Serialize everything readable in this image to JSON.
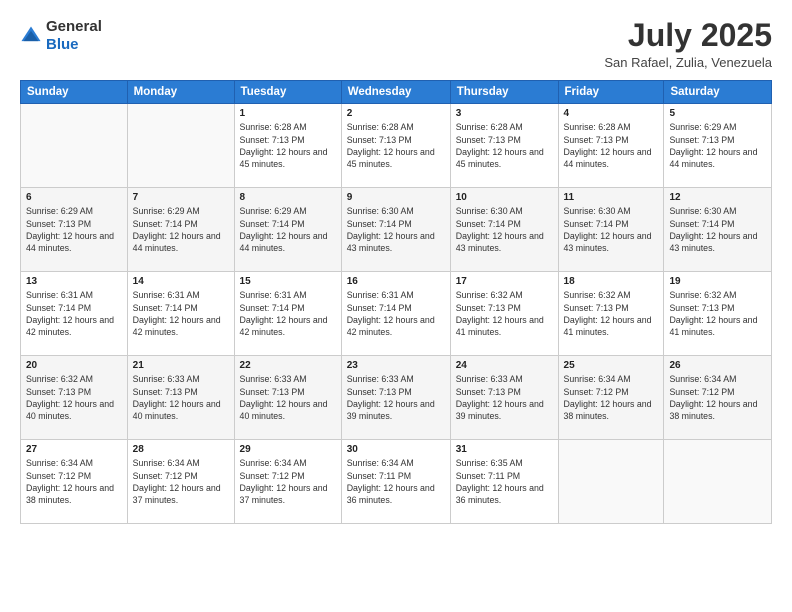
{
  "logo": {
    "general": "General",
    "blue": "Blue"
  },
  "title": {
    "month_year": "July 2025",
    "location": "San Rafael, Zulia, Venezuela"
  },
  "weekdays": [
    "Sunday",
    "Monday",
    "Tuesday",
    "Wednesday",
    "Thursday",
    "Friday",
    "Saturday"
  ],
  "weeks": [
    [
      {
        "day": "",
        "info": ""
      },
      {
        "day": "",
        "info": ""
      },
      {
        "day": "1",
        "sunrise": "6:28 AM",
        "sunset": "7:13 PM",
        "daylight": "12 hours and 45 minutes."
      },
      {
        "day": "2",
        "sunrise": "6:28 AM",
        "sunset": "7:13 PM",
        "daylight": "12 hours and 45 minutes."
      },
      {
        "day": "3",
        "sunrise": "6:28 AM",
        "sunset": "7:13 PM",
        "daylight": "12 hours and 45 minutes."
      },
      {
        "day": "4",
        "sunrise": "6:28 AM",
        "sunset": "7:13 PM",
        "daylight": "12 hours and 44 minutes."
      },
      {
        "day": "5",
        "sunrise": "6:29 AM",
        "sunset": "7:13 PM",
        "daylight": "12 hours and 44 minutes."
      }
    ],
    [
      {
        "day": "6",
        "sunrise": "6:29 AM",
        "sunset": "7:13 PM",
        "daylight": "12 hours and 44 minutes."
      },
      {
        "day": "7",
        "sunrise": "6:29 AM",
        "sunset": "7:14 PM",
        "daylight": "12 hours and 44 minutes."
      },
      {
        "day": "8",
        "sunrise": "6:29 AM",
        "sunset": "7:14 PM",
        "daylight": "12 hours and 44 minutes."
      },
      {
        "day": "9",
        "sunrise": "6:30 AM",
        "sunset": "7:14 PM",
        "daylight": "12 hours and 43 minutes."
      },
      {
        "day": "10",
        "sunrise": "6:30 AM",
        "sunset": "7:14 PM",
        "daylight": "12 hours and 43 minutes."
      },
      {
        "day": "11",
        "sunrise": "6:30 AM",
        "sunset": "7:14 PM",
        "daylight": "12 hours and 43 minutes."
      },
      {
        "day": "12",
        "sunrise": "6:30 AM",
        "sunset": "7:14 PM",
        "daylight": "12 hours and 43 minutes."
      }
    ],
    [
      {
        "day": "13",
        "sunrise": "6:31 AM",
        "sunset": "7:14 PM",
        "daylight": "12 hours and 42 minutes."
      },
      {
        "day": "14",
        "sunrise": "6:31 AM",
        "sunset": "7:14 PM",
        "daylight": "12 hours and 42 minutes."
      },
      {
        "day": "15",
        "sunrise": "6:31 AM",
        "sunset": "7:14 PM",
        "daylight": "12 hours and 42 minutes."
      },
      {
        "day": "16",
        "sunrise": "6:31 AM",
        "sunset": "7:14 PM",
        "daylight": "12 hours and 42 minutes."
      },
      {
        "day": "17",
        "sunrise": "6:32 AM",
        "sunset": "7:13 PM",
        "daylight": "12 hours and 41 minutes."
      },
      {
        "day": "18",
        "sunrise": "6:32 AM",
        "sunset": "7:13 PM",
        "daylight": "12 hours and 41 minutes."
      },
      {
        "day": "19",
        "sunrise": "6:32 AM",
        "sunset": "7:13 PM",
        "daylight": "12 hours and 41 minutes."
      }
    ],
    [
      {
        "day": "20",
        "sunrise": "6:32 AM",
        "sunset": "7:13 PM",
        "daylight": "12 hours and 40 minutes."
      },
      {
        "day": "21",
        "sunrise": "6:33 AM",
        "sunset": "7:13 PM",
        "daylight": "12 hours and 40 minutes."
      },
      {
        "day": "22",
        "sunrise": "6:33 AM",
        "sunset": "7:13 PM",
        "daylight": "12 hours and 40 minutes."
      },
      {
        "day": "23",
        "sunrise": "6:33 AM",
        "sunset": "7:13 PM",
        "daylight": "12 hours and 39 minutes."
      },
      {
        "day": "24",
        "sunrise": "6:33 AM",
        "sunset": "7:13 PM",
        "daylight": "12 hours and 39 minutes."
      },
      {
        "day": "25",
        "sunrise": "6:34 AM",
        "sunset": "7:12 PM",
        "daylight": "12 hours and 38 minutes."
      },
      {
        "day": "26",
        "sunrise": "6:34 AM",
        "sunset": "7:12 PM",
        "daylight": "12 hours and 38 minutes."
      }
    ],
    [
      {
        "day": "27",
        "sunrise": "6:34 AM",
        "sunset": "7:12 PM",
        "daylight": "12 hours and 38 minutes."
      },
      {
        "day": "28",
        "sunrise": "6:34 AM",
        "sunset": "7:12 PM",
        "daylight": "12 hours and 37 minutes."
      },
      {
        "day": "29",
        "sunrise": "6:34 AM",
        "sunset": "7:12 PM",
        "daylight": "12 hours and 37 minutes."
      },
      {
        "day": "30",
        "sunrise": "6:34 AM",
        "sunset": "7:11 PM",
        "daylight": "12 hours and 36 minutes."
      },
      {
        "day": "31",
        "sunrise": "6:35 AM",
        "sunset": "7:11 PM",
        "daylight": "12 hours and 36 minutes."
      },
      {
        "day": "",
        "info": ""
      },
      {
        "day": "",
        "info": ""
      }
    ]
  ]
}
